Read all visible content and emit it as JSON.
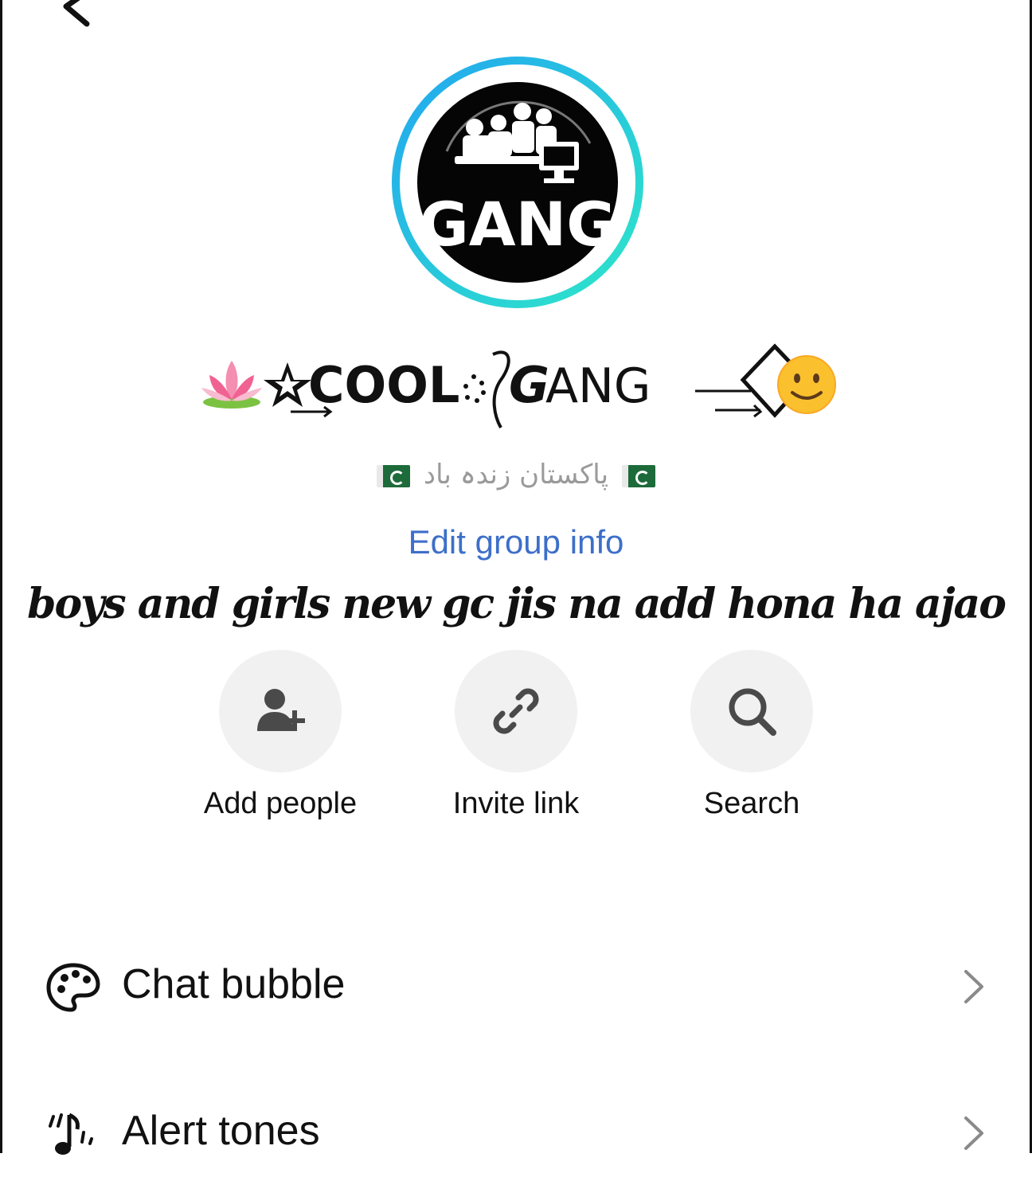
{
  "header": {
    "back_icon": "chevron-left-icon"
  },
  "group": {
    "avatar_text": "GANG",
    "name": "🪷☆COOL⊚GANG",
    "name_emoji_left": "🪷",
    "name_emoji_right": "🙂",
    "subtitle": "پاکستان زندہ باد",
    "edit_link": "Edit group info",
    "description": "boys and girls new gc jis na add hona ha ajao"
  },
  "actions": [
    {
      "label": "Add people",
      "icon": "add-person-icon"
    },
    {
      "label": "Invite link",
      "icon": "link-icon"
    },
    {
      "label": "Search",
      "icon": "search-icon"
    }
  ],
  "settings": [
    {
      "label": "Chat bubble",
      "icon": "palette-icon"
    },
    {
      "label": "Alert tones",
      "icon": "music-note-icon"
    }
  ],
  "colors": {
    "accent_link": "#3d6fc9",
    "avatar_ring_start": "#22a7f0",
    "avatar_ring_end": "#2ee6c9",
    "action_circle": "#f1f1f1",
    "muted_text": "#9a9a9a"
  }
}
